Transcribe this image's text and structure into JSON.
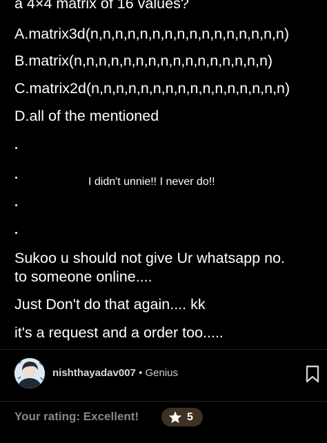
{
  "question_tail": "a 4×4 matrix of 16 values?",
  "options": {
    "a": "A.matrix3d(n,n,n,n,n,n,n,n,n,n,n,n,n,n,n,n)",
    "b": "B.matrix(n,n,n,n,n,n,n,n,n,n,n,n,n,n,n,n)",
    "c": "C.matrix2d(n,n,n,n,n,n,n,n,n,n,n,n,n,n,n,n)",
    "d": "D.all of the mentioned"
  },
  "overlay_text": "I didn't unnie!! I never do!!",
  "message": {
    "line1": "Sukoo u should not give Ur whatsapp no.",
    "line2": "to someone online....",
    "line3": "Just Don't do that again.... kk",
    "line4": "it's a request and a order too....."
  },
  "author": {
    "username": "nishthayadav007",
    "separator": " • ",
    "level": "Genius"
  },
  "rating": {
    "label": "Your rating: Excellent!",
    "value": "5"
  },
  "colors": {
    "background": "#000000",
    "rating_label": "#7f8a92",
    "rating_badge": "#3f3223",
    "star": "#f7c64a"
  },
  "icons": {
    "bookmark": "bookmark-icon",
    "star": "star-icon"
  }
}
